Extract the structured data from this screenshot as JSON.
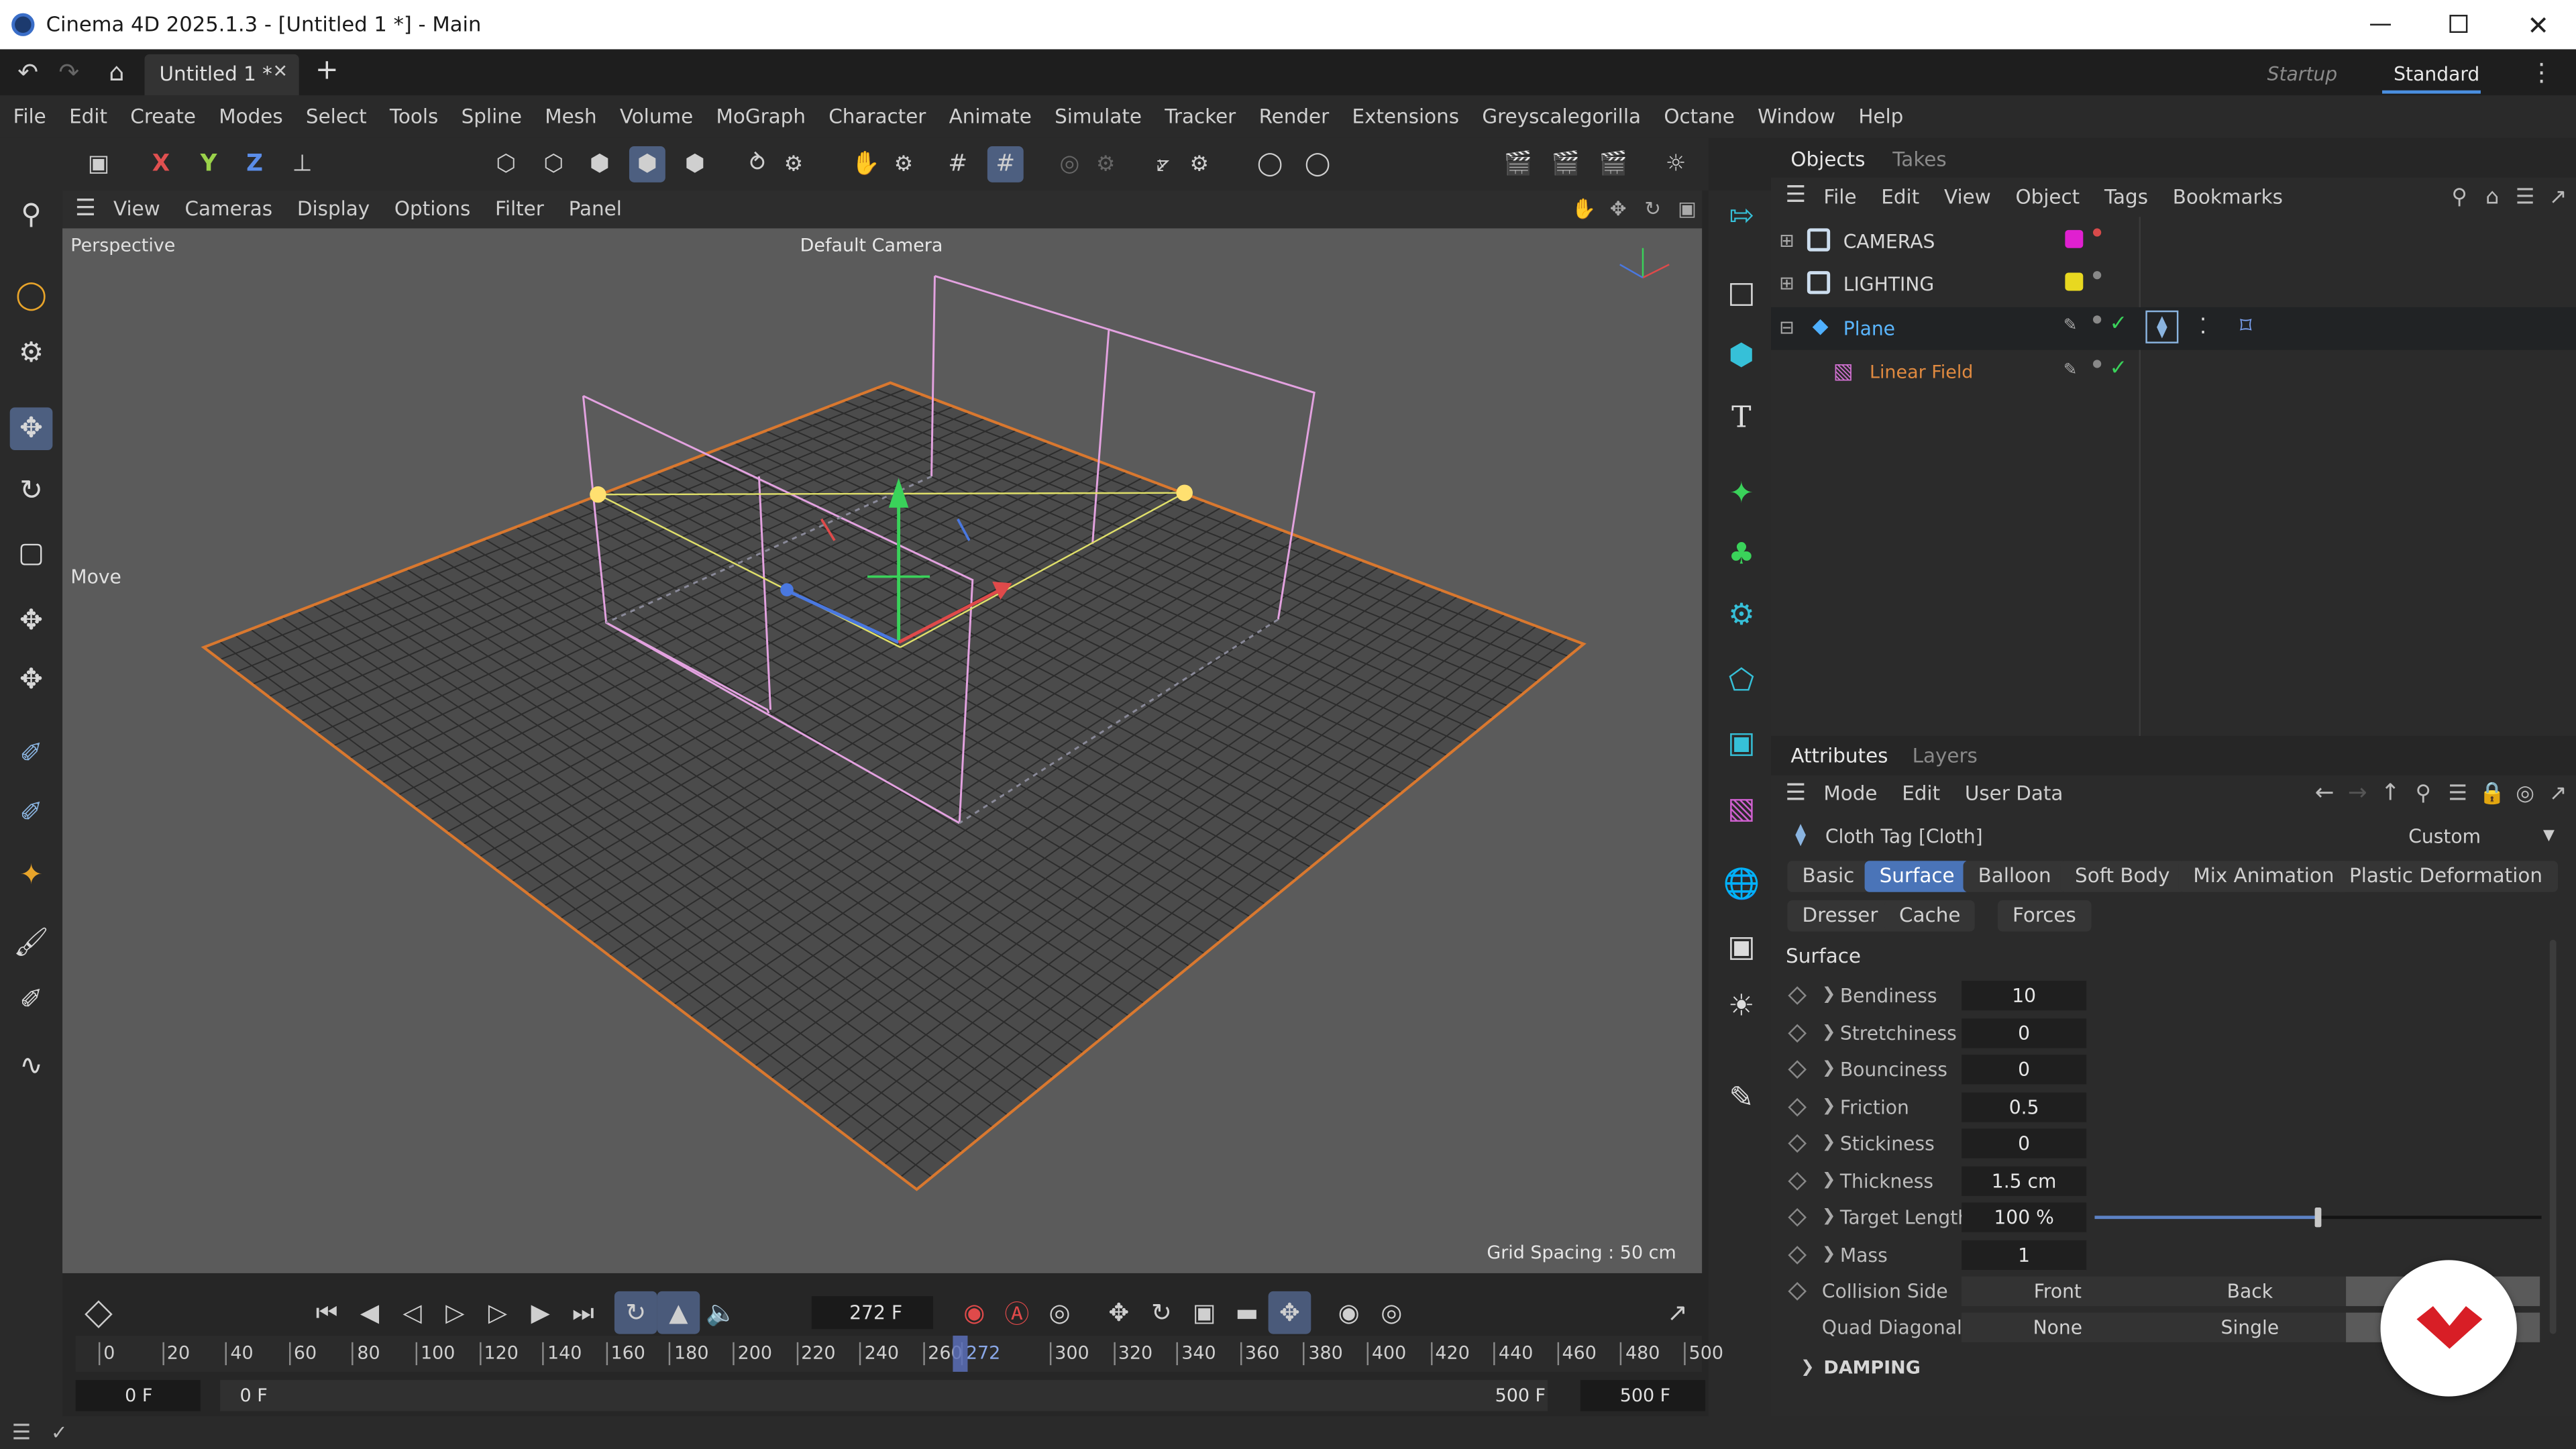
{
  "window": {
    "title": "Cinema 4D 2025.1.3 - [Untitled 1 *] - Main"
  },
  "tabs": {
    "document": "Untitled 1 *",
    "layouts": [
      "Startup",
      "Standard"
    ],
    "active_layout": "Standard"
  },
  "menu": [
    "File",
    "Edit",
    "Create",
    "Modes",
    "Select",
    "Tools",
    "Spline",
    "Mesh",
    "Volume",
    "MoGraph",
    "Character",
    "Animate",
    "Simulate",
    "Tracker",
    "Render",
    "Extensions",
    "Greyscalegorilla",
    "Octane",
    "Window",
    "Help"
  ],
  "axis_toolbar": {
    "x": "X",
    "y": "Y",
    "z": "Z"
  },
  "viewport": {
    "menu": [
      "View",
      "Cameras",
      "Display",
      "Options",
      "Filter",
      "Panel"
    ],
    "view_name": "Perspective",
    "camera": "Default Camera",
    "grid_spacing": "Grid Spacing : 50 cm",
    "tool_label": "Move"
  },
  "objects_panel": {
    "tabs": [
      "Objects",
      "Takes"
    ],
    "menu": [
      "File",
      "Edit",
      "View",
      "Object",
      "Tags",
      "Bookmarks"
    ],
    "items": [
      {
        "name": "CAMERAS",
        "color": "#e020d0"
      },
      {
        "name": "LIGHTING",
        "color": "#e8d820"
      },
      {
        "name": "Plane",
        "color": "#4fb0ff"
      },
      {
        "name": "Linear Field",
        "color": "#e08a40"
      }
    ]
  },
  "attributes_panel": {
    "tabs": [
      "Attributes",
      "Layers"
    ],
    "menu": [
      "Mode",
      "Edit",
      "User Data"
    ],
    "object_title": "Cloth Tag [Cloth]",
    "preset": "Custom",
    "tag_tabs": [
      "Basic",
      "Surface",
      "Balloon",
      "Soft Body",
      "Mix Animation",
      "Plastic Deformation",
      "Dresser",
      "Cache",
      "Forces"
    ],
    "active_tab": "Surface",
    "section": "Surface",
    "params": [
      {
        "label": "Bendiness",
        "value": "10"
      },
      {
        "label": "Stretchiness",
        "value": "0"
      },
      {
        "label": "Bounciness",
        "value": "0"
      },
      {
        "label": "Friction",
        "value": "0.5"
      },
      {
        "label": "Stickiness",
        "value": "0"
      },
      {
        "label": "Thickness",
        "value": "1.5 cm"
      },
      {
        "label": "Target Length",
        "value": "100 %",
        "slider_fraction": 0.5
      },
      {
        "label": "Mass",
        "value": "1"
      }
    ],
    "collision_side": {
      "label": "Collision Side",
      "options": [
        "Front",
        "Back"
      ]
    },
    "quad_diagonals": {
      "label": "Quad Diagonals",
      "options": [
        "None",
        "Single"
      ]
    },
    "damping_header": "DAMPING"
  },
  "timeline": {
    "current_frame": "272 F",
    "ticks": [
      "0",
      "20",
      "40",
      "60",
      "80",
      "100",
      "120",
      "140",
      "160",
      "180",
      "200",
      "220",
      "240",
      "260",
      "272",
      "300",
      "320",
      "340",
      "360",
      "380",
      "400",
      "420",
      "440",
      "460",
      "480",
      "500"
    ],
    "playhead_value": 272,
    "range_max": 500,
    "start": "0 F",
    "range_start": "0 F",
    "range_end": "500 F",
    "end": "500 F"
  }
}
